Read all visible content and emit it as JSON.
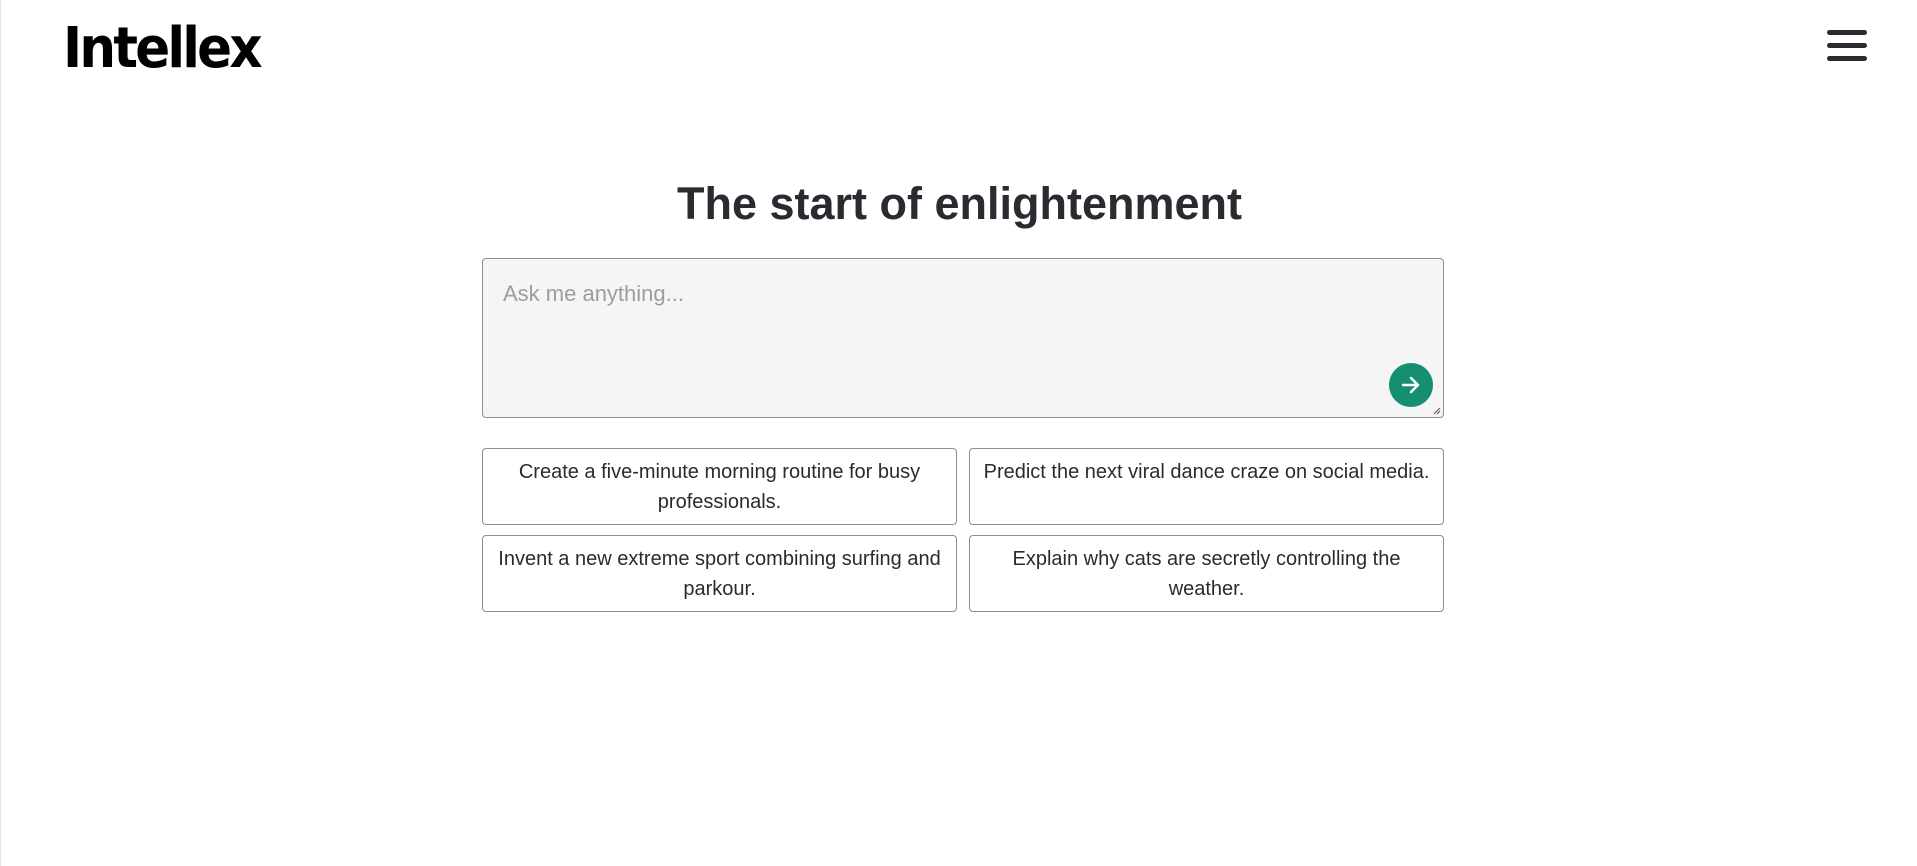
{
  "header": {
    "logo_text": "Intellex",
    "menu_icon": "hamburger-menu-icon"
  },
  "main": {
    "headline": "The start of enlightenment",
    "ask_input": {
      "placeholder": "Ask me anything...",
      "value": ""
    },
    "send_icon": "arrow-right-icon",
    "send_button_color": "#148f72",
    "suggestions": [
      "Create a five-minute morning routine for busy professionals.",
      "Predict the next viral dance craze on social media.",
      "Invent a new extreme sport combining surfing and parkour.",
      "Explain why cats are secretly controlling the weather."
    ]
  }
}
